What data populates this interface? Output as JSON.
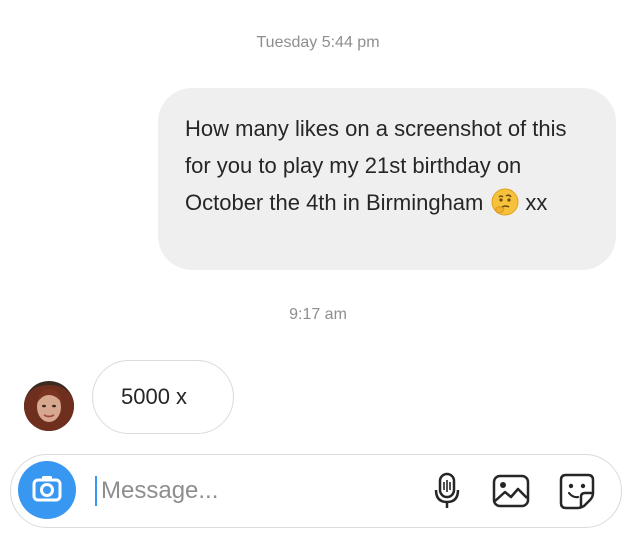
{
  "conversation": {
    "timestamp_1": "Tuesday 5:44 pm",
    "sent_message_text": "How many likes on a screenshot of this for you to play my 21st birthday on October the 4th in Birmingham",
    "sent_message_suffix": "xx",
    "timestamp_2": "9:17 am",
    "received_message_text": "5000 x"
  },
  "composer": {
    "placeholder": "Message..."
  },
  "icons": {
    "camera": "camera-icon",
    "microphone": "microphone-icon",
    "gallery": "gallery-icon",
    "sticker": "sticker-icon",
    "emoji": "thinking-face-emoji"
  },
  "colors": {
    "accent": "#3897f0",
    "sent_bubble": "#efefef",
    "muted_text": "#8e8e8e",
    "border": "#dbdbdb"
  }
}
